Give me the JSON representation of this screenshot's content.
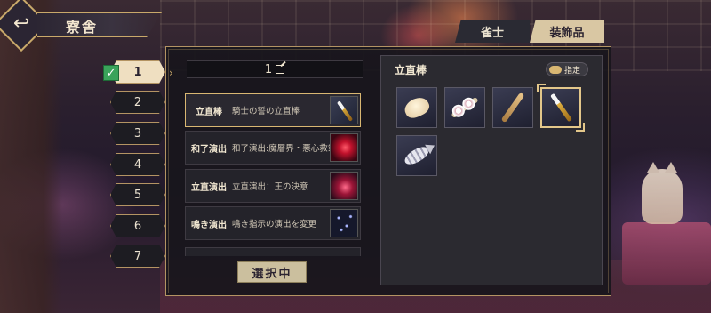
{
  "header": {
    "back_icon": "back-arrow-icon",
    "title": "寮舎"
  },
  "tabs": [
    {
      "label": "雀士",
      "active": false
    },
    {
      "label": "装飾品",
      "active": true
    }
  ],
  "loadouts": [
    {
      "label": "1",
      "active": true
    },
    {
      "label": "2",
      "active": false
    },
    {
      "label": "3",
      "active": false
    },
    {
      "label": "4",
      "active": false
    },
    {
      "label": "5",
      "active": false
    },
    {
      "label": "6",
      "active": false
    },
    {
      "label": "7",
      "active": false
    }
  ],
  "current_loadout": {
    "number": "1",
    "edit_icon": "edit-icon"
  },
  "slots": [
    {
      "type": "立直棒",
      "name": "騎士の誓の立直棒",
      "thumb": "riichi-stick-thumb"
    },
    {
      "type": "和了演出",
      "name": "和了演出:魔層界・悪心救祭",
      "thumb": "red-effect-thumb"
    },
    {
      "type": "立直演出",
      "name": "立直演出：王の決意",
      "thumb": "crystal-effect-thumb"
    },
    {
      "type": "鳴き演出",
      "name": "鳴き指示の演出を変更",
      "thumb": "stars-effect-thumb"
    }
  ],
  "selected_button_label": "選択中",
  "item_panel": {
    "title": "立直棒",
    "toggle_label": "指定",
    "items": [
      {
        "icon": "bun-icon",
        "selected": false
      },
      {
        "icon": "skewer-icon",
        "selected": false
      },
      {
        "icon": "bat-icon",
        "selected": false
      },
      {
        "icon": "knight-stick-icon",
        "selected": true
      },
      {
        "icon": "fish-icon",
        "selected": false
      }
    ]
  },
  "colors": {
    "accent_gold": "#c9a96a",
    "active_tab": "#d9c7a3",
    "check_green": "#3aa35a"
  }
}
